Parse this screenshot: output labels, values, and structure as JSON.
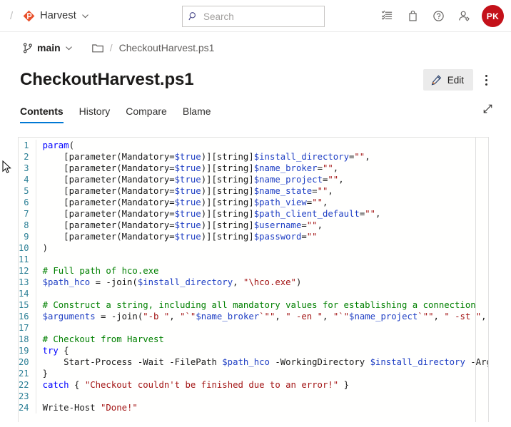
{
  "topbar": {
    "leading_slash": "/",
    "org_name": "Harvest",
    "org_logo_color": "#e8502a",
    "search_placeholder": "Search",
    "search_value": "",
    "icons": [
      {
        "name": "checklist-icon",
        "title": "Work items"
      },
      {
        "name": "shopping-bag-icon",
        "title": "Marketplace"
      },
      {
        "name": "help-circle-icon",
        "title": "Help"
      },
      {
        "name": "user-settings-icon",
        "title": "User settings"
      }
    ],
    "avatar_initials": "PK",
    "avatar_color": "#c4111a"
  },
  "breadcrumb": {
    "branch": "main",
    "separator": "/",
    "file": "CheckoutHarvest.ps1"
  },
  "title": {
    "text": "CheckoutHarvest.ps1",
    "edit_label": "Edit"
  },
  "tabs": [
    {
      "label": "Contents",
      "active": true
    },
    {
      "label": "History",
      "active": false
    },
    {
      "label": "Compare",
      "active": false
    },
    {
      "label": "Blame",
      "active": false
    }
  ],
  "accent_color": "#0078d4",
  "code": {
    "language": "powershell",
    "first_line": 1,
    "last_line": 24,
    "lines": [
      {
        "n": 1,
        "text": "param("
      },
      {
        "n": 2,
        "text": "    [parameter(Mandatory=$true)][string]$install_directory=\"\","
      },
      {
        "n": 3,
        "text": "    [parameter(Mandatory=$true)][string]$name_broker=\"\","
      },
      {
        "n": 4,
        "text": "    [parameter(Mandatory=$true)][string]$name_project=\"\","
      },
      {
        "n": 5,
        "text": "    [parameter(Mandatory=$true)][string]$name_state=\"\","
      },
      {
        "n": 6,
        "text": "    [parameter(Mandatory=$true)][string]$path_view=\"\","
      },
      {
        "n": 7,
        "text": "    [parameter(Mandatory=$true)][string]$path_client_default=\"\","
      },
      {
        "n": 8,
        "text": "    [parameter(Mandatory=$true)][string]$username=\"\","
      },
      {
        "n": 9,
        "text": "    [parameter(Mandatory=$true)][string]$password=\"\""
      },
      {
        "n": 10,
        "text": ")"
      },
      {
        "n": 11,
        "text": ""
      },
      {
        "n": 12,
        "text": "# Full path of hco.exe"
      },
      {
        "n": 13,
        "text": "$path_hco = -join($install_directory, \"\\hco.exe\")"
      },
      {
        "n": 14,
        "text": ""
      },
      {
        "n": 15,
        "text": "# Construct a string, including all mandatory values for establishing a connection"
      },
      {
        "n": 16,
        "text": "$arguments = -join(\"-b \", \"`\"$name_broker`\"\", \" -en \", \"`\"$name_project`\"\", \" -st \", \"`\""
      },
      {
        "n": 17,
        "text": ""
      },
      {
        "n": 18,
        "text": "# Checkout from Harvest"
      },
      {
        "n": 19,
        "text": "try {"
      },
      {
        "n": 20,
        "text": "    Start-Process -Wait -FilePath $path_hco -WorkingDirectory $install_directory -Argum"
      },
      {
        "n": 21,
        "text": "}"
      },
      {
        "n": 22,
        "text": "catch { \"Checkout couldn't be finished due to an error!\" }"
      },
      {
        "n": 23,
        "text": ""
      },
      {
        "n": 24,
        "text": "Write-Host \"Done!\""
      }
    ],
    "tokens": [
      {
        "n": 1,
        "parts": [
          [
            "kw",
            "param"
          ],
          [
            "pln",
            "("
          ]
        ]
      },
      {
        "n": 2,
        "parts": [
          [
            "pln",
            "    [parameter(Mandatory="
          ],
          [
            "var",
            "$true"
          ],
          [
            "pln",
            ")][string]"
          ],
          [
            "var",
            "$install_directory"
          ],
          [
            "pln",
            "="
          ],
          [
            "str",
            "\"\""
          ],
          [
            "pln",
            ","
          ]
        ]
      },
      {
        "n": 3,
        "parts": [
          [
            "pln",
            "    [parameter(Mandatory="
          ],
          [
            "var",
            "$true"
          ],
          [
            "pln",
            ")][string]"
          ],
          [
            "var",
            "$name_broker"
          ],
          [
            "pln",
            "="
          ],
          [
            "str",
            "\"\""
          ],
          [
            "pln",
            ","
          ]
        ]
      },
      {
        "n": 4,
        "parts": [
          [
            "pln",
            "    [parameter(Mandatory="
          ],
          [
            "var",
            "$true"
          ],
          [
            "pln",
            ")][string]"
          ],
          [
            "var",
            "$name_project"
          ],
          [
            "pln",
            "="
          ],
          [
            "str",
            "\"\""
          ],
          [
            "pln",
            ","
          ]
        ]
      },
      {
        "n": 5,
        "parts": [
          [
            "pln",
            "    [parameter(Mandatory="
          ],
          [
            "var",
            "$true"
          ],
          [
            "pln",
            ")][string]"
          ],
          [
            "var",
            "$name_state"
          ],
          [
            "pln",
            "="
          ],
          [
            "str",
            "\"\""
          ],
          [
            "pln",
            ","
          ]
        ]
      },
      {
        "n": 6,
        "parts": [
          [
            "pln",
            "    [parameter(Mandatory="
          ],
          [
            "var",
            "$true"
          ],
          [
            "pln",
            ")][string]"
          ],
          [
            "var",
            "$path_view"
          ],
          [
            "pln",
            "="
          ],
          [
            "str",
            "\"\""
          ],
          [
            "pln",
            ","
          ]
        ]
      },
      {
        "n": 7,
        "parts": [
          [
            "pln",
            "    [parameter(Mandatory="
          ],
          [
            "var",
            "$true"
          ],
          [
            "pln",
            ")][string]"
          ],
          [
            "var",
            "$path_client_default"
          ],
          [
            "pln",
            "="
          ],
          [
            "str",
            "\"\""
          ],
          [
            "pln",
            ","
          ]
        ]
      },
      {
        "n": 8,
        "parts": [
          [
            "pln",
            "    [parameter(Mandatory="
          ],
          [
            "var",
            "$true"
          ],
          [
            "pln",
            ")][string]"
          ],
          [
            "var",
            "$username"
          ],
          [
            "pln",
            "="
          ],
          [
            "str",
            "\"\""
          ],
          [
            "pln",
            ","
          ]
        ]
      },
      {
        "n": 9,
        "parts": [
          [
            "pln",
            "    [parameter(Mandatory="
          ],
          [
            "var",
            "$true"
          ],
          [
            "pln",
            ")][string]"
          ],
          [
            "var",
            "$password"
          ],
          [
            "pln",
            "="
          ],
          [
            "str",
            "\"\""
          ]
        ]
      },
      {
        "n": 10,
        "parts": [
          [
            "pln",
            ")"
          ]
        ]
      },
      {
        "n": 11,
        "parts": []
      },
      {
        "n": 12,
        "parts": [
          [
            "cmt",
            "# Full path of hco.exe"
          ]
        ]
      },
      {
        "n": 13,
        "parts": [
          [
            "var",
            "$path_hco"
          ],
          [
            "pln",
            " = -join("
          ],
          [
            "var",
            "$install_directory"
          ],
          [
            "pln",
            ", "
          ],
          [
            "str",
            "\"\\hco.exe\""
          ],
          [
            "pln",
            ")"
          ]
        ]
      },
      {
        "n": 14,
        "parts": []
      },
      {
        "n": 15,
        "parts": [
          [
            "cmt",
            "# Construct a string, including all mandatory values for establishing a connection"
          ]
        ]
      },
      {
        "n": 16,
        "parts": [
          [
            "var",
            "$arguments"
          ],
          [
            "pln",
            " = -join("
          ],
          [
            "str",
            "\"-b \""
          ],
          [
            "pln",
            ", "
          ],
          [
            "str",
            "\"`\""
          ],
          [
            "var",
            "$name_broker"
          ],
          [
            "str",
            "`\"\""
          ],
          [
            "pln",
            ", "
          ],
          [
            "str",
            "\" -en \""
          ],
          [
            "pln",
            ", "
          ],
          [
            "str",
            "\"`\""
          ],
          [
            "var",
            "$name_project"
          ],
          [
            "str",
            "`\"\""
          ],
          [
            "pln",
            ", "
          ],
          [
            "str",
            "\" -st \""
          ],
          [
            "pln",
            ", "
          ],
          [
            "str",
            "\"`"
          ]
        ]
      },
      {
        "n": 17,
        "parts": []
      },
      {
        "n": 18,
        "parts": [
          [
            "cmt",
            "# Checkout from Harvest"
          ]
        ]
      },
      {
        "n": 19,
        "parts": [
          [
            "kw",
            "try"
          ],
          [
            "pln",
            " {"
          ]
        ]
      },
      {
        "n": 20,
        "parts": [
          [
            "pln",
            "    Start-Process -Wait -FilePath "
          ],
          [
            "var",
            "$path_hco"
          ],
          [
            "pln",
            " -WorkingDirectory "
          ],
          [
            "var",
            "$install_directory"
          ],
          [
            "pln",
            " -Argum"
          ]
        ]
      },
      {
        "n": 21,
        "parts": [
          [
            "pln",
            "}"
          ]
        ]
      },
      {
        "n": 22,
        "parts": [
          [
            "kw",
            "catch"
          ],
          [
            "pln",
            " { "
          ],
          [
            "str",
            "\"Checkout couldn't be finished due to an error!\""
          ],
          [
            "pln",
            " }"
          ]
        ]
      },
      {
        "n": 23,
        "parts": []
      },
      {
        "n": 24,
        "parts": [
          [
            "pln",
            "Write-Host "
          ],
          [
            "str",
            "\"Done!\""
          ]
        ]
      }
    ]
  }
}
